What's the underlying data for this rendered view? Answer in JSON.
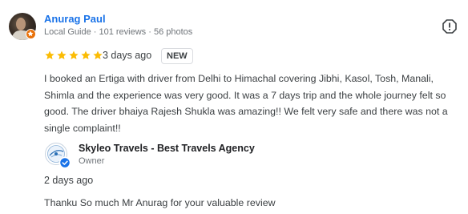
{
  "review": {
    "reviewer_name": "Anurag Paul",
    "reviewer_meta": "Local Guide · 101 reviews · 56 photos",
    "rating": 5,
    "rating_max": 5,
    "date": "3 days ago",
    "badge": "NEW",
    "text_lines": [
      "I booked an Ertiga with driver from Delhi to Himachal covering Jibhi, Kasol, Tosh, Manali,",
      "Shimla and the experience was very good. It was a 7 days trip and the whole journey felt so",
      "good. The driver bhaiya Rajesh Shukla was amazing!! We felt very safe and there was not a",
      "single complaint!!"
    ]
  },
  "owner_response": {
    "business_name": "Skyleo Travels - Best Travels Agency",
    "role": "Owner",
    "date": "2 days ago",
    "text": "Thanku So much Mr Anurag for your valuable review"
  },
  "icons": {
    "avatar": "reviewer-avatar",
    "local_guide": "local-guide-badge-icon",
    "report": "report-flag-icon",
    "star": "star-icon",
    "verified": "verified-check-icon"
  },
  "colors": {
    "name_link": "#1a73e8",
    "star": "#fbbc04",
    "local_guide_badge": "#e8710a",
    "verified_badge": "#1a73e8"
  }
}
